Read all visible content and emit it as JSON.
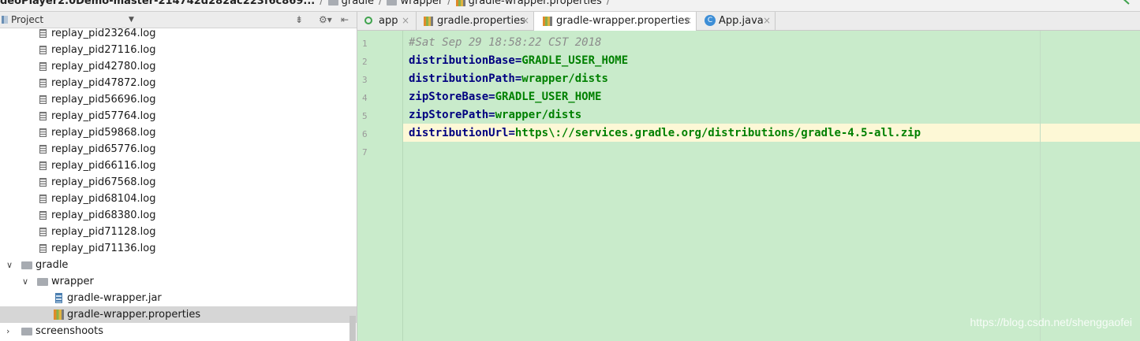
{
  "breadcrumb": {
    "items": [
      "deoPlayer2.0Demo-master-214742d282ac223f6c869...",
      "gradle",
      "wrapper",
      "gradle-wrapper.properties"
    ],
    "separator": "/"
  },
  "project_panel": {
    "title": "Project",
    "tree": [
      {
        "label": "replay_pid23264.log",
        "type": "file"
      },
      {
        "label": "replay_pid27116.log",
        "type": "file"
      },
      {
        "label": "replay_pid42780.log",
        "type": "file"
      },
      {
        "label": "replay_pid47872.log",
        "type": "file"
      },
      {
        "label": "replay_pid56696.log",
        "type": "file"
      },
      {
        "label": "replay_pid57764.log",
        "type": "file"
      },
      {
        "label": "replay_pid59868.log",
        "type": "file"
      },
      {
        "label": "replay_pid65776.log",
        "type": "file"
      },
      {
        "label": "replay_pid66116.log",
        "type": "file"
      },
      {
        "label": "replay_pid67568.log",
        "type": "file"
      },
      {
        "label": "replay_pid68104.log",
        "type": "file"
      },
      {
        "label": "replay_pid68380.log",
        "type": "file"
      },
      {
        "label": "replay_pid71128.log",
        "type": "file"
      },
      {
        "label": "replay_pid71136.log",
        "type": "file"
      },
      {
        "label": "gradle",
        "type": "folder",
        "expanded": true
      },
      {
        "label": "wrapper",
        "type": "folder",
        "expanded": true
      },
      {
        "label": "gradle-wrapper.jar",
        "type": "jar"
      },
      {
        "label": "gradle-wrapper.properties",
        "type": "properties",
        "selected": true
      },
      {
        "label": "screenshoots",
        "type": "folder",
        "expanded": false
      }
    ]
  },
  "tabs": [
    {
      "label": "app",
      "icon": "module-icon",
      "close": "×"
    },
    {
      "label": "gradle.properties",
      "icon": "properties-icon",
      "close": "×"
    },
    {
      "label": "gradle-wrapper.properties",
      "icon": "properties-icon",
      "close": "×",
      "active": true
    },
    {
      "label": "App.java",
      "icon": "java-class-icon",
      "close": "×"
    }
  ],
  "editor": {
    "line_numbers": [
      "1",
      "2",
      "3",
      "4",
      "5",
      "6",
      "7"
    ],
    "current_line": 6,
    "lines": [
      {
        "comment": "#Sat Sep 29 18:58:22 CST 2018"
      },
      {
        "key": "distributionBase",
        "eq": "=",
        "value": "GRADLE_USER_HOME"
      },
      {
        "key": "distributionPath",
        "eq": "=",
        "value": "wrapper/dists"
      },
      {
        "key": "zipStoreBase",
        "eq": "=",
        "value": "GRADLE_USER_HOME"
      },
      {
        "key": "zipStorePath",
        "eq": "=",
        "value": "wrapper/dists"
      },
      {
        "key": "distributionUrl",
        "eq": "=",
        "value": "https\\://services.gradle.org/distributions/gradle-4.5-all.zip"
      }
    ]
  },
  "watermark": "https://blog.csdn.net/shenggaofei",
  "colors": {
    "editor_bg": "#c9ebcb",
    "current_line_bg": "#fdf8d6",
    "key": "#000080",
    "value": "#008000",
    "selected_row": "#d6d6d6"
  }
}
